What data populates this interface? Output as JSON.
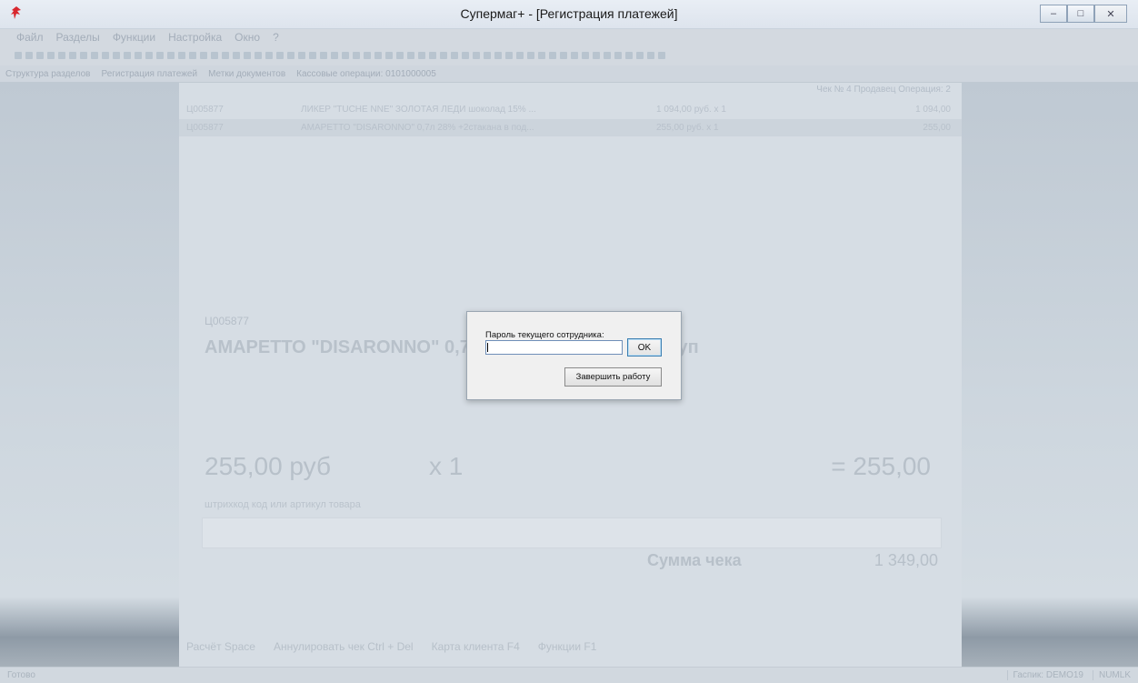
{
  "window": {
    "title": "Супермаг+  - [Регистрация платежей]",
    "buttons": {
      "minimize": "–",
      "maximize": "□",
      "close": "✕"
    }
  },
  "menu": [
    "Файл",
    "Разделы",
    "Функции",
    "Настройка",
    "Окно",
    "?"
  ],
  "tabs": [
    "Структура разделов",
    "Регистрация платежей",
    "Метки документов",
    "Кассовые операции: 0101000005"
  ],
  "receipt": {
    "header_info": "Чек № 4    Продавец   Операция: 2",
    "rows": [
      {
        "code": "Ц005877",
        "name": "ЛИКЕР \"TUCHE NNE\" ЗОЛОТАЯ ЛЕДИ шоколад 15% ...",
        "price": "1 094,00 руб. х 1",
        "sum": "1 094,00"
      },
      {
        "code": "Ц005877",
        "name": "АМАРЕТТО \"DISARONNO\" 0,7л 28% +2стакана в под...",
        "price": "255,00 руб. х 1",
        "sum": "255,00"
      }
    ],
    "current_code": "Ц005877",
    "current_name": "АМАРЕТТО \"DISARONNO\" 0,7л 28% +2стакана в под.уп",
    "price": "255,00 руб",
    "qty": "х 1",
    "total": "= 255,00",
    "barcode_label": "штрихкод код или артикул товара",
    "sum_label": "Сумма чека",
    "sum_value": "1 349,00",
    "hints": [
      "Расчёт Space",
      "Аннулировать чек Ctrl + Del",
      "Карта клиента F4",
      "Функции F1"
    ]
  },
  "status": {
    "left": "Готово",
    "right": [
      "Гаспик: DEMO19",
      "NUMLK"
    ]
  },
  "dialog": {
    "label": "Пароль текущего сотрудника:",
    "password_value": "",
    "ok": "OK",
    "finish": "Завершить работу"
  }
}
